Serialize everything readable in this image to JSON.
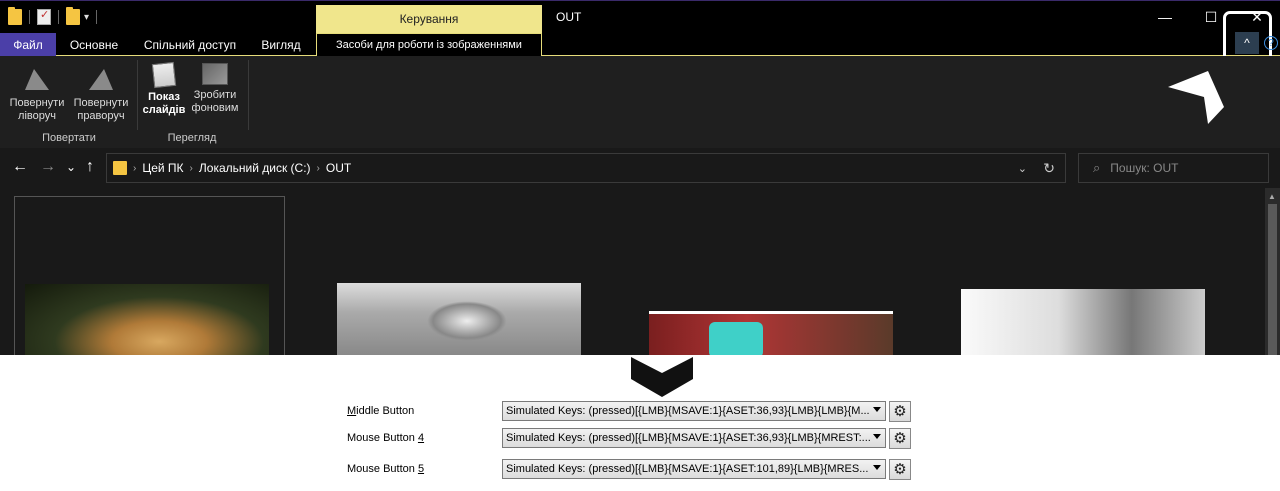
{
  "window": {
    "title": "OUT",
    "context_header": "Керування",
    "minimize": "—",
    "maximize": "☐",
    "close": "✕"
  },
  "tabs": [
    {
      "label": "Файл"
    },
    {
      "label": "Основне"
    },
    {
      "label": "Спільний доступ"
    },
    {
      "label": "Вигляд"
    },
    {
      "label": "Засоби для роботи із зображеннями"
    }
  ],
  "ribbon": {
    "rotate_left": "Повернути ліворуч",
    "rotate_right": "Повернути праворуч",
    "slideshow": "Показ слайдів",
    "set_background": "Зробити фоновим",
    "group_rotate": "Повертати",
    "group_view": "Перегляд",
    "collapse_icon": "^",
    "help_icon": "?"
  },
  "navigation": {
    "back": "←",
    "forward": "→",
    "recent": "⌄",
    "up": "↑",
    "breadcrumbs": [
      "Цей ПК",
      "Локальний диск (C:)",
      "OUT"
    ],
    "search_placeholder": "Пошук: OUT"
  },
  "mouse_config": {
    "rows": [
      {
        "label_prefix": "",
        "label_underline": "M",
        "label_rest": "iddle Button",
        "value": "Simulated Keys: (pressed)[{LMB}{MSAVE:1}{ASET:36,93}{LMB}{LMB}{M..."
      },
      {
        "label_prefix": "Mouse Button ",
        "label_underline": "4",
        "label_rest": "",
        "value": "Simulated Keys: (pressed)[{LMB}{MSAVE:1}{ASET:36,93}{LMB}{MREST:..."
      },
      {
        "label_prefix": "Mouse Button ",
        "label_underline": "5",
        "label_rest": "",
        "value": "Simulated Keys: (pressed)[{LMB}{MSAVE:1}{ASET:101,89}{LMB}{MRES..."
      }
    ]
  },
  "colors": {
    "file_tab": "#4b3fa8",
    "context_accent": "#f0e68c",
    "explorer_bg": "#191919"
  }
}
